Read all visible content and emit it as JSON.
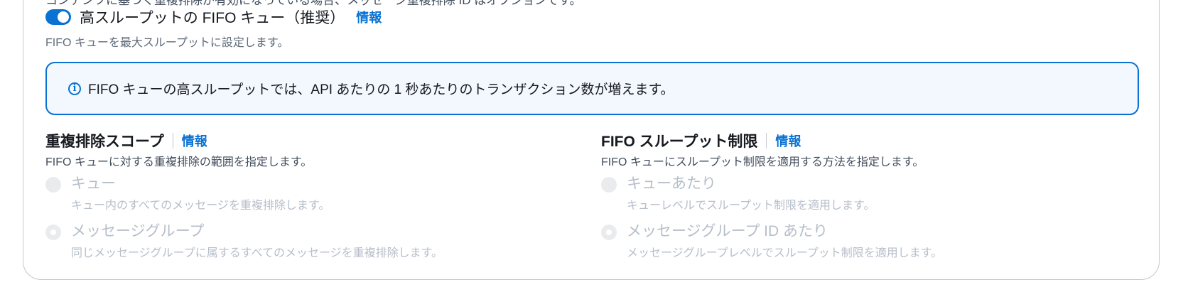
{
  "top_cut_text": "コンテンツに基づく重複排除が有効になっている場合、メッセージ重複排除 ID はオプションです。",
  "throughput": {
    "toggle_label": "高スループットの FIFO キュー（推奨）",
    "info_link": "情報",
    "description": "FIFO キューを最大スループットに設定します。",
    "enabled": true
  },
  "alert": {
    "icon": "info-circle-icon",
    "text": "FIFO キューの高スループットでは、API あたりの 1 秒あたりのトランザクション数が増えます。"
  },
  "dedup_scope": {
    "title": "重複排除スコープ",
    "info_link": "情報",
    "description": "FIFO キューに対する重複排除の範囲を指定します。",
    "options": [
      {
        "label": "キュー",
        "description": "キュー内のすべてのメッセージを重複排除します。",
        "selected": false
      },
      {
        "label": "メッセージグループ",
        "description": "同じメッセージグループに属するすべてのメッセージを重複排除します。",
        "selected": true
      }
    ]
  },
  "throughput_limit": {
    "title": "FIFO スループット制限",
    "info_link": "情報",
    "description": "FIFO キューにスループット制限を適用する方法を指定します。",
    "options": [
      {
        "label": "キューあたり",
        "description": "キューレベルでスループット制限を適用します。",
        "selected": false
      },
      {
        "label": "メッセージグループ ID あたり",
        "description": "メッセージグループレベルでスループット制限を適用します。",
        "selected": true
      }
    ]
  },
  "colors": {
    "accent": "#0972d3",
    "alert_background": "#f2f8fd",
    "disabled_text": "#b6bec9"
  }
}
